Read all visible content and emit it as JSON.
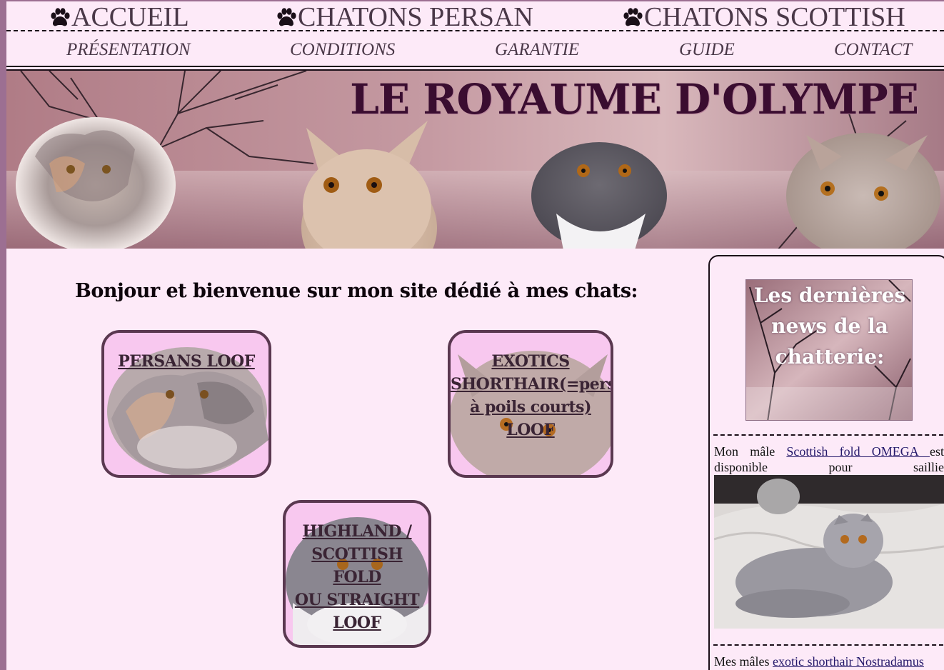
{
  "top_nav": [
    {
      "label": "ACCUEIL",
      "icon": "paw-icon"
    },
    {
      "label": "CHATONS PERSAN",
      "icon": "paw-icon"
    },
    {
      "label": "CHATONS SCOTTISH",
      "icon": "paw-icon"
    }
  ],
  "sub_nav": [
    "PRÉSENTATION",
    "CONDITIONS",
    "GARANTIE",
    "GUIDE",
    "CONTACT"
  ],
  "banner": {
    "title": "LE ROYAUME D'OLYMPE"
  },
  "main": {
    "welcome": "Bonjour et bienvenue sur mon site dédié à mes chats:",
    "cards": [
      {
        "lines": [
          "PERSANS LOOF"
        ]
      },
      {
        "lines": [
          "EXOTICS",
          "SHORTHAIR(=persan",
          "à poils courts) LOOF"
        ]
      },
      {
        "lines": [
          "HIGHLAND /",
          "SCOTTISH FOLD",
          "OU STRAIGHT",
          "LOOF"
        ]
      }
    ]
  },
  "sidebar": {
    "news_title": [
      "Les dernières",
      "news de la",
      "chatterie:"
    ],
    "item1": {
      "pre": "Mon mâle ",
      "link": "Scottish fold OMEGA ",
      "post": "est disponible pour saillie"
    },
    "item2": {
      "pre": "Mes mâles ",
      "link": "exotic shorthair Nostradamus"
    }
  },
  "colors": {
    "background": "#fdeaf8",
    "accent": "#9c6f92",
    "title": "#3a0d30",
    "link": "#24186a"
  }
}
